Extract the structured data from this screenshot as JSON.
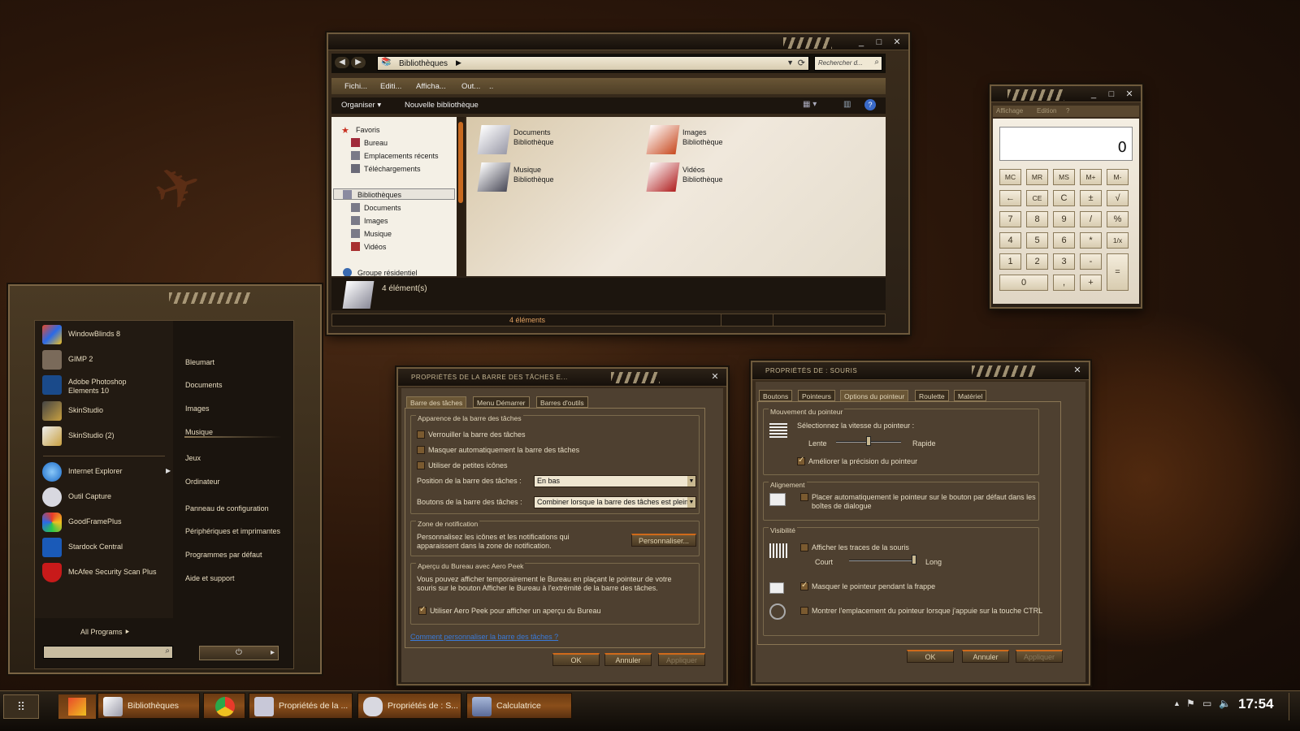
{
  "explorer": {
    "address_segment": "Bibliothèques",
    "search_placeholder": "Rechercher d...",
    "menu": [
      "Fichi...",
      "Editi...",
      "Afficha...",
      "Out...",
      ".."
    ],
    "toolbar": {
      "organize": "Organiser",
      "new_library": "Nouvelle bibliothèque"
    },
    "nav": {
      "favorites": "Favoris",
      "favorites_items": [
        "Bureau",
        "Emplacements récents",
        "Téléchargements"
      ],
      "libraries": "Bibliothèques",
      "libraries_items": [
        "Documents",
        "Images",
        "Musique",
        "Vidéos"
      ],
      "homegroup": "Groupe résidentiel"
    },
    "items": [
      {
        "name": "Documents",
        "type": "Bibliothèque"
      },
      {
        "name": "Images",
        "type": "Bibliothèque"
      },
      {
        "name": "Musique",
        "type": "Bibliothèque"
      },
      {
        "name": "Vidéos",
        "type": "Bibliothèque"
      }
    ],
    "details_count": "4 élément(s)",
    "status_count": "4 éléments"
  },
  "calculator": {
    "menu": [
      "Affichage",
      "Edition",
      "?"
    ],
    "display": "0",
    "keys": [
      "MC",
      "MR",
      "MS",
      "M+",
      "M-",
      "←",
      "CE",
      "C",
      "±",
      "√",
      "7",
      "8",
      "9",
      "/",
      "%",
      "4",
      "5",
      "6",
      "*",
      "1/x",
      "1",
      "2",
      "3",
      "-",
      "=",
      "0",
      ",",
      "+"
    ]
  },
  "start_menu": {
    "programs": [
      {
        "label": "WindowBlinds 8"
      },
      {
        "label": "GIMP 2"
      },
      {
        "label": "Adobe Photoshop\nElements 10"
      },
      {
        "label": "SkinStudio"
      },
      {
        "label": "SkinStudio (2)"
      },
      {
        "label": "Internet Explorer"
      },
      {
        "label": "Outil Capture"
      },
      {
        "label": "GoodFramePlus"
      },
      {
        "label": "Stardock Central"
      },
      {
        "label": "McAfee Security Scan Plus"
      }
    ],
    "places": [
      "Bleumart",
      "Documents",
      "Images",
      "Musique",
      "Jeux",
      "Ordinateur",
      "Panneau de configuration",
      "Périphériques et imprimantes",
      "Programmes par défaut",
      "Aide et support"
    ],
    "all_programs": "All Programs"
  },
  "taskbar_props": {
    "title": "Propriétés de la barre des tâches e...",
    "tabs": [
      "Barre des tâches",
      "Menu Démarrer",
      "Barres d'outils"
    ],
    "group_appearance": "Apparence de la barre des tâches",
    "chk_lock": "Verrouiller la barre des tâches",
    "chk_autohide": "Masquer automatiquement la barre des tâches",
    "chk_small": "Utiliser de petites icônes",
    "position_label": "Position de la barre des tâches :",
    "position_value": "En bas",
    "buttons_label": "Boutons de la barre des tâches :",
    "buttons_value": "Combiner lorsque la barre des tâches est pleine",
    "group_notif": "Zone de notification",
    "notif_text": "Personnalisez les icônes et les notifications qui apparaissent dans la zone de notification.",
    "customize": "Personnaliser...",
    "group_peek": "Aperçu du Bureau avec Aero Peek",
    "peek_text": "Vous pouvez afficher temporairement le Bureau en plaçant le pointeur de votre souris sur le bouton Afficher le Bureau à l'extrémité de la barre des tâches.",
    "chk_peek": "Utiliser Aero Peek pour afficher un aperçu du Bureau",
    "link": "Comment personnaliser la barre des tâches ?",
    "ok": "OK",
    "cancel": "Annuler",
    "apply": "Appliquer"
  },
  "mouse_props": {
    "title": "Propriétés de : Souris",
    "tabs": [
      "Boutons",
      "Pointeurs",
      "Options du pointeur",
      "Roulette",
      "Matériel"
    ],
    "group_motion": "Mouvement du pointeur",
    "speed_label": "Sélectionnez la vitesse du pointeur :",
    "slow": "Lente",
    "fast": "Rapide",
    "speed_level": 0.5,
    "chk_precision": "Améliorer la précision du pointeur",
    "group_snap": "Alignement",
    "snap_text": "Placer automatiquement le pointeur sur le bouton par défaut dans les boîtes de dialogue",
    "group_visibility": "Visibilité",
    "chk_trails": "Afficher les traces de la souris",
    "short": "Court",
    "long": "Long",
    "trail_level": 1.0,
    "chk_hide": "Masquer le pointeur pendant la frappe",
    "chk_ctrl": "Montrer l'emplacement du pointeur lorsque j'appuie sur la touche CTRL",
    "ok": "OK",
    "cancel": "Annuler",
    "apply": "Appliquer"
  },
  "taskbar": {
    "items": [
      {
        "label": "Bibliothèques"
      },
      {
        "label": ""
      },
      {
        "label": "Propriétés de la ..."
      },
      {
        "label": "Propriétés de : S..."
      },
      {
        "label": "Calculatrice"
      }
    ],
    "clock": "17:54"
  }
}
